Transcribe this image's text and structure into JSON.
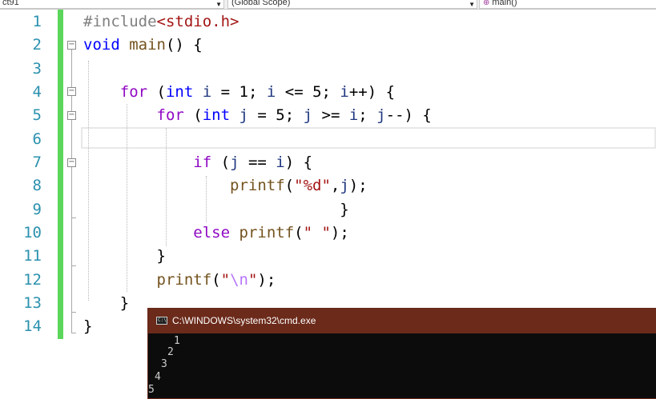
{
  "nav": {
    "project": "ct91",
    "scope": "(Global Scope)",
    "member": "main()"
  },
  "editor": {
    "line_numbers": [
      "1",
      "2",
      "3",
      "4",
      "5",
      "6",
      "7",
      "8",
      "9",
      "10",
      "11",
      "12",
      "13",
      "14"
    ]
  },
  "console": {
    "title": "C:\\WINDOWS\\system32\\cmd.exe",
    "output": [
      "1",
      "2",
      "3",
      "4",
      "5"
    ]
  },
  "colors": {
    "keyword": "#0000ff",
    "control": "#8f08c4",
    "function": "#74531f",
    "string": "#a31515",
    "line_number": "#2b91af",
    "change_bar": "#5bd65b",
    "console_title": "#6b2a1a"
  }
}
